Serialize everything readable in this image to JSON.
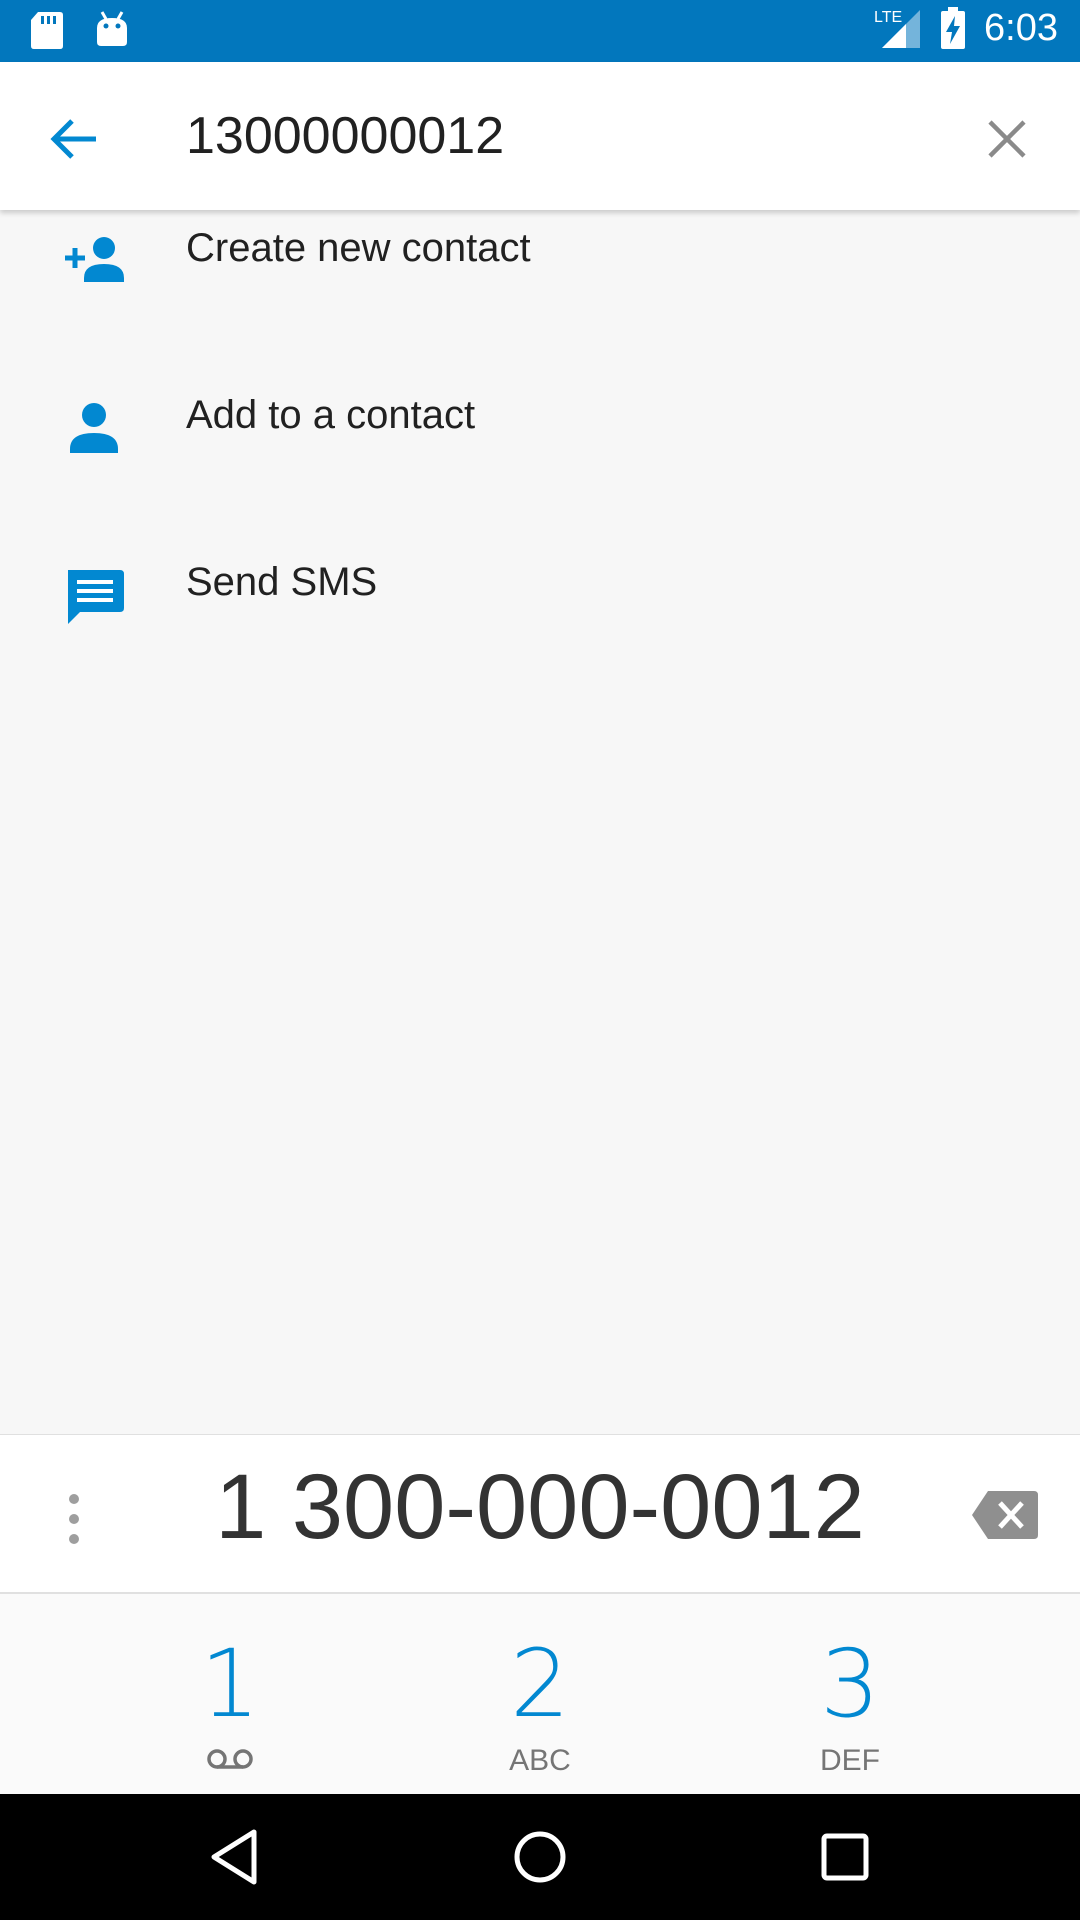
{
  "status_bar": {
    "time": "6:03",
    "network_label": "LTE",
    "icons": [
      "sd-card-icon",
      "android-icon",
      "lte-signal-icon",
      "battery-charging-icon"
    ]
  },
  "search": {
    "value": "13000000012",
    "back_icon": "arrow-back-icon",
    "clear_icon": "close-icon"
  },
  "actions": [
    {
      "label": "Create new contact",
      "icon": "person-add-icon"
    },
    {
      "label": "Add to a contact",
      "icon": "person-icon"
    },
    {
      "label": "Send SMS",
      "icon": "message-icon"
    }
  ],
  "dialer": {
    "digits": "1 300-000-0012",
    "overflow_icon": "more-vert-icon",
    "backspace_icon": "backspace-icon"
  },
  "keypad": {
    "keys": [
      {
        "digit": "1",
        "letters": ""
      },
      {
        "digit": "2",
        "letters": "ABC"
      },
      {
        "digit": "3",
        "letters": "DEF"
      }
    ]
  },
  "colors": {
    "status_bar": "#0277bd",
    "accent": "#0288d1",
    "background": "#f7f7f7"
  }
}
